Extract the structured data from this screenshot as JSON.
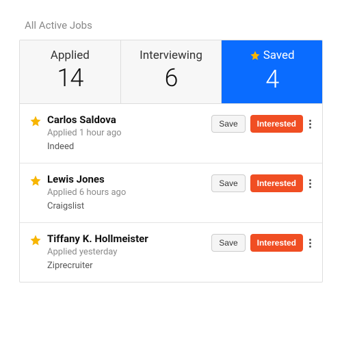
{
  "title": "All Active Jobs",
  "tabs": [
    {
      "label": "Applied",
      "count": "14",
      "starred": false,
      "active": false
    },
    {
      "label": "Interviewing",
      "count": "6",
      "starred": false,
      "active": false
    },
    {
      "label": "Saved",
      "count": "4",
      "starred": true,
      "active": true
    }
  ],
  "buttons": {
    "save": "Save",
    "interested": "Interested"
  },
  "applicants": [
    {
      "name": "Carlos Saldova",
      "meta": "Applied 1 hour ago",
      "source": "Indeed"
    },
    {
      "name": "Lewis Jones",
      "meta": "Applied 6 hours ago",
      "source": "Craigslist"
    },
    {
      "name": "Tiffany K. Hollmeister",
      "meta": "Applied yesterday",
      "source": "Ziprecruiter"
    }
  ],
  "colors": {
    "accent": "#0a6cff",
    "action": "#f04e23",
    "star": "#f7b500"
  }
}
